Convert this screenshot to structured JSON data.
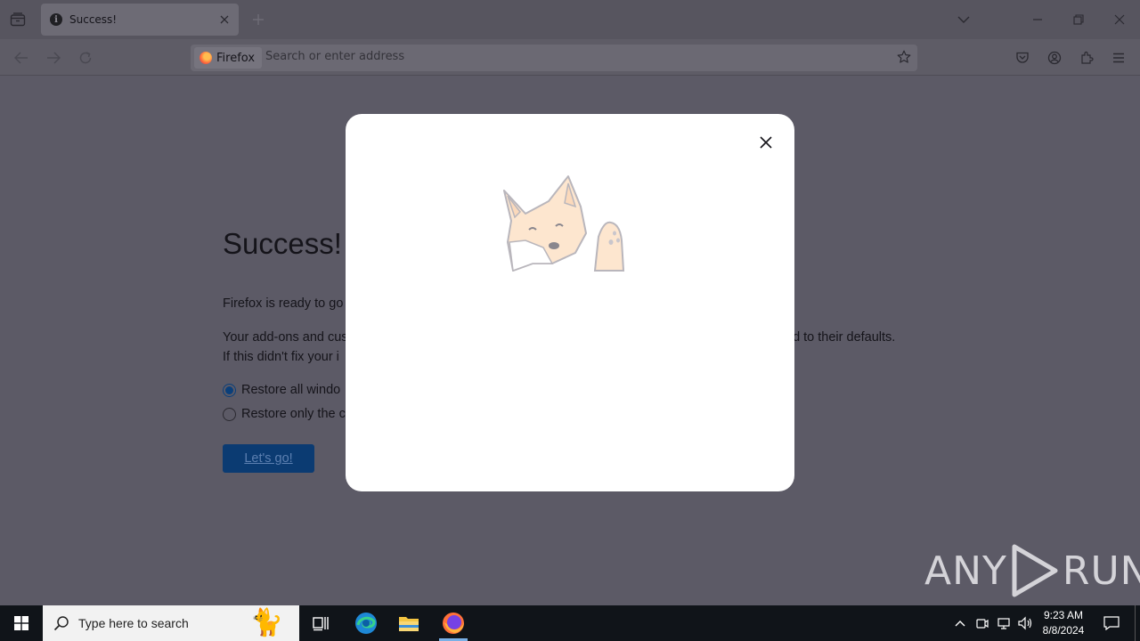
{
  "browser": {
    "tab": {
      "title": "Success!",
      "favicon": "info-icon"
    },
    "urlbar": {
      "identity_label": "Firefox",
      "placeholder": "Search or enter address"
    }
  },
  "page": {
    "title": "Success!",
    "ready_text": "Firefox is ready to go",
    "para1_visible": "Your add-ons and cus",
    "para1_tail": "ed to their defaults.",
    "para2_visible": "If this didn't fix your i",
    "radio_options": [
      {
        "label": "Restore all windo",
        "checked": true
      },
      {
        "label": "Restore only the c",
        "checked": false
      }
    ],
    "button_label": "Let's go!"
  },
  "modal": {
    "illustration": "waving-fox-illustration"
  },
  "watermark": {
    "left": "ANY",
    "right": "RUN"
  },
  "taskbar": {
    "search_placeholder": "Type here to search",
    "clock_time": "9:23 AM",
    "clock_date": "8/8/2024"
  },
  "colors": {
    "overlay_bg": "#5c5a66",
    "primary_button": "#0b3b72",
    "modal_bg": "#ffffff",
    "taskbar_bg": "#101419"
  }
}
